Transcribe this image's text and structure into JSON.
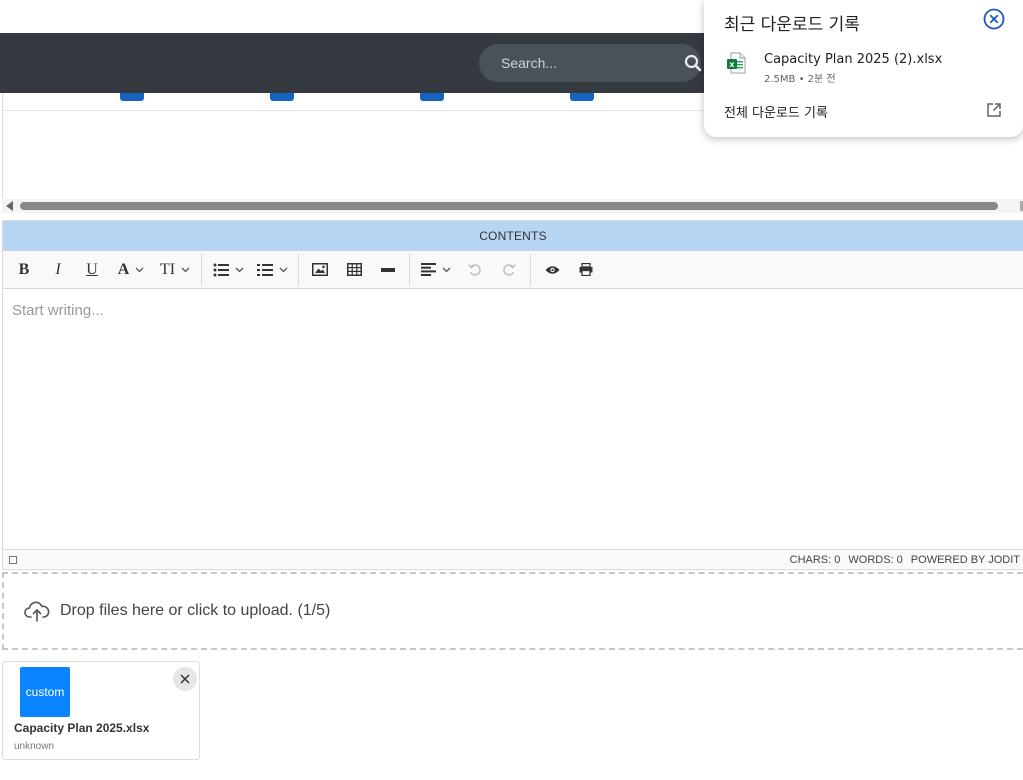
{
  "header": {
    "search_placeholder": "Search..."
  },
  "editor": {
    "header_label": "CONTENTS",
    "placeholder": "Start writing...",
    "toolbar": {
      "bold": "B",
      "italic": "I",
      "underline": "U",
      "font_color": "A",
      "font_size": "TI"
    },
    "status": {
      "chars": "CHARS: 0",
      "words": "WORDS: 0",
      "powered": "POWERED BY JODIT"
    }
  },
  "upload": {
    "dropzone_text": "Drop files here or click to upload. (1/5)",
    "file": {
      "thumb_label": "custom",
      "name": "Capacity Plan 2025.xlsx",
      "sub": "unknown"
    }
  },
  "downloads_popup": {
    "title": "최근 다운로드 기록",
    "file_name": "Capacity Plan 2025 (2).xlsx",
    "file_meta": "2.5MB • 2분 전",
    "all_link": "전체 다운로드 기록"
  },
  "colors": {
    "topbar": "#343a40",
    "editor_header": "#b7d4f2",
    "accent_blue": "#1565c0",
    "thumb_blue": "#0a84ff"
  }
}
